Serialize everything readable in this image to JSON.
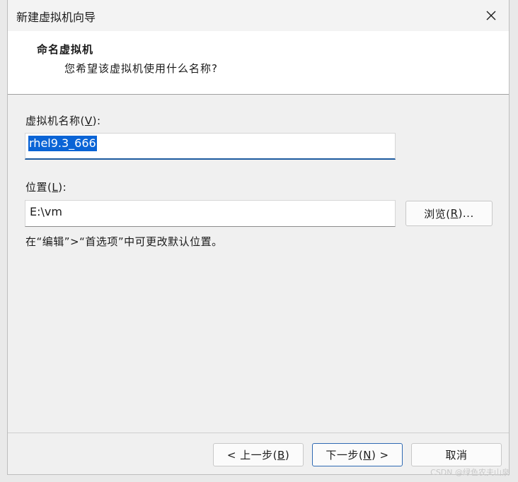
{
  "window": {
    "title": "新建虚拟机向导"
  },
  "header": {
    "title": "命名虚拟机",
    "subtitle": "您希望该虚拟机使用什么名称?"
  },
  "vm_name": {
    "label_prefix": "虚拟机名称(",
    "label_key": "V",
    "label_suffix": "):",
    "value": "rhel9.3_666"
  },
  "location": {
    "label_prefix": "位置(",
    "label_key": "L",
    "label_suffix": "):",
    "value": "E:\\vm",
    "browse_prefix": "浏览(",
    "browse_key": "R",
    "browse_suffix": ")..."
  },
  "hint": "在“编辑”>“首选项”中可更改默认位置。",
  "footer": {
    "back_prefix": "< 上一步(",
    "back_key": "B",
    "back_suffix": ")",
    "next_prefix": "下一步(",
    "next_key": "N",
    "next_suffix": ") >",
    "cancel": "取消"
  },
  "watermark": "CSDN @绿色农夫山泉",
  "colors": {
    "selection": "#0a64d6",
    "focus_underline": "#1c5a9f"
  }
}
